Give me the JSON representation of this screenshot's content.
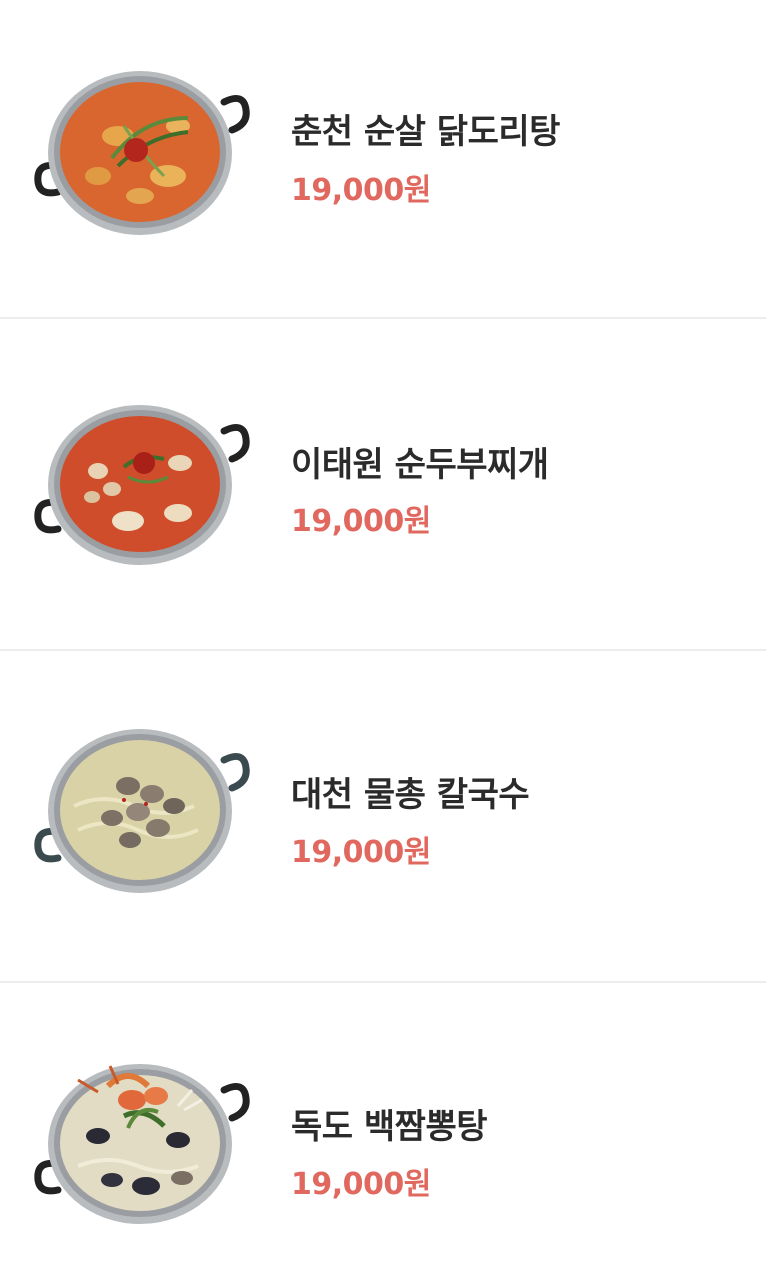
{
  "menu": {
    "items": [
      {
        "name": "춘천 순살 닭도리탕",
        "price": "19,000원",
        "image_icon": "spicy-chicken-stew-pot-icon",
        "broth_color": "#d9662f"
      },
      {
        "name": "이태원 순두부찌개",
        "price": "19,000원",
        "image_icon": "soft-tofu-stew-pot-icon",
        "broth_color": "#cf4d2a"
      },
      {
        "name": "대천 물총 칼국수",
        "price": "19,000원",
        "image_icon": "clam-noodle-soup-pot-icon",
        "broth_color": "#d8d2a6"
      },
      {
        "name": "독도 백짬뽕탕",
        "price": "19,000원",
        "image_icon": "white-seafood-jjamppong-pot-icon",
        "broth_color": "#e3dcc4"
      }
    ]
  },
  "colors": {
    "price": "#e0685f",
    "name": "#2b2b2b",
    "divider": "#ececec"
  }
}
